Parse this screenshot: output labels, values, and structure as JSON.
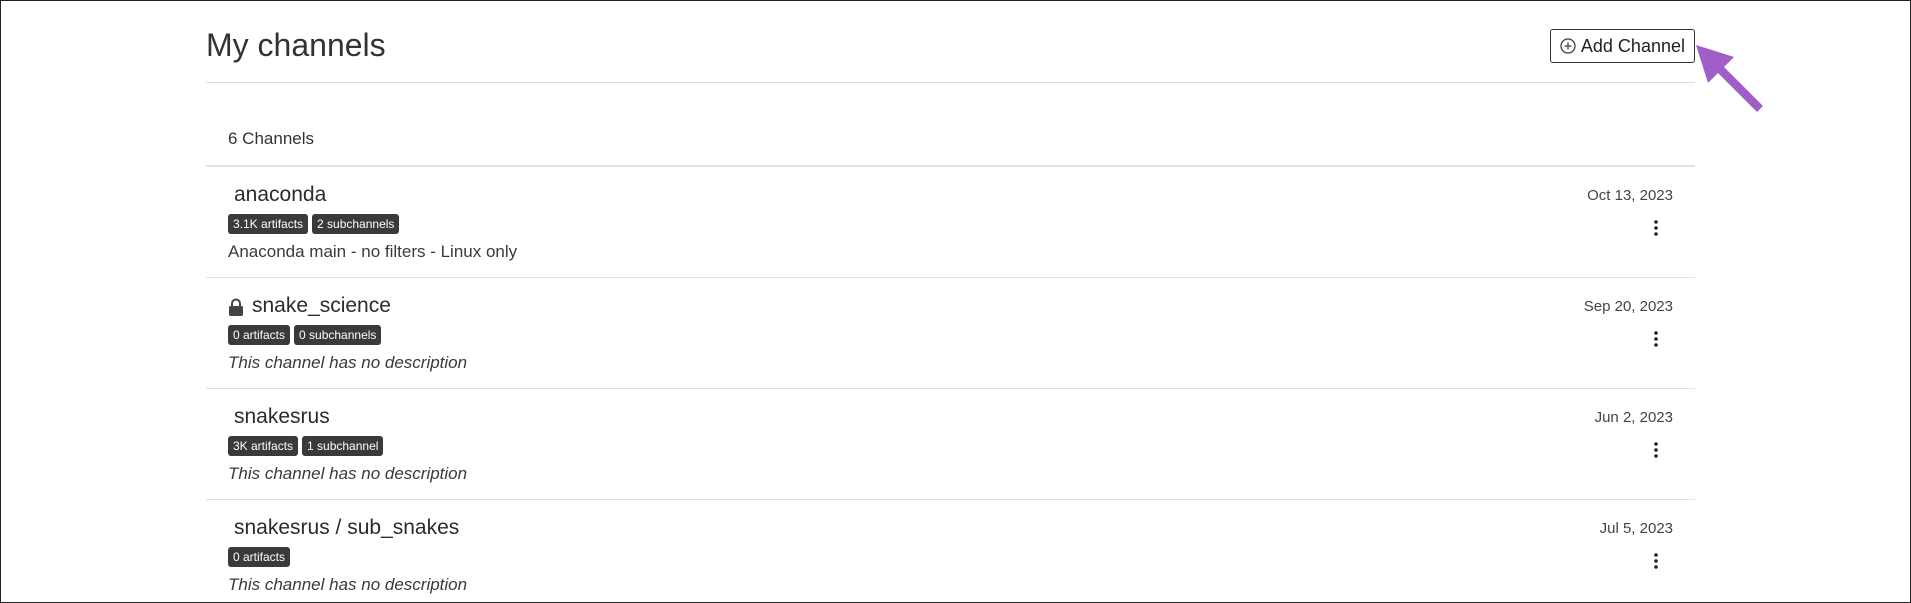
{
  "header": {
    "title": "My channels",
    "add_button_label": "Add Channel",
    "add_button_icon": "plus-circle-icon"
  },
  "list": {
    "count_label": "6 Channels"
  },
  "channels": [
    {
      "name": "anaconda",
      "locked": false,
      "badges": [
        "3.1K artifacts",
        "2 subchannels"
      ],
      "description": "Anaconda main - no filters - Linux only",
      "date": "Oct 13, 2023"
    },
    {
      "name": "snake_science",
      "locked": true,
      "badges": [
        "0 artifacts",
        "0 subchannels"
      ],
      "description": "This channel has no description",
      "date": "Sep 20, 2023"
    },
    {
      "name": "snakesrus",
      "locked": false,
      "badges": [
        "3K artifacts",
        "1 subchannel"
      ],
      "description": "This channel has no description",
      "date": "Jun 2, 2023"
    },
    {
      "name": "snakesrus / sub_snakes",
      "locked": false,
      "badges": [
        "0 artifacts"
      ],
      "description": "This channel has no description",
      "date": "Jul 5, 2023"
    }
  ],
  "annotation": {
    "arrow_color": "#a25ec8"
  }
}
